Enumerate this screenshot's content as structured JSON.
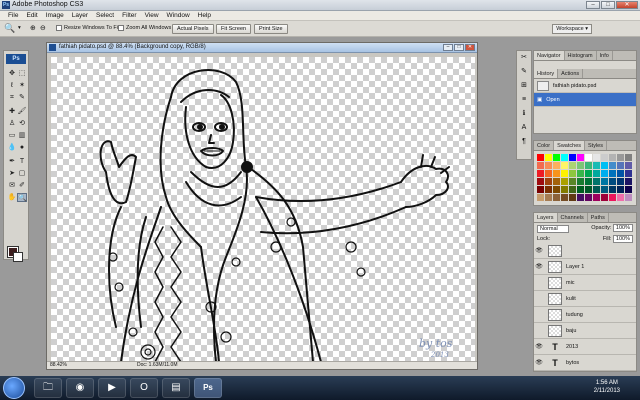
{
  "window": {
    "title": "Adobe Photoshop CS3"
  },
  "menu": [
    "File",
    "Edit",
    "Image",
    "Layer",
    "Select",
    "Filter",
    "View",
    "Window",
    "Help"
  ],
  "options": {
    "resize_windows": "Resize Windows To Fit",
    "zoom_all": "Zoom All Windows",
    "actual_pixels": "Actual Pixels",
    "fit_screen": "Fit Screen",
    "print_size": "Print Size",
    "workspace": "Workspace"
  },
  "tools": {
    "logo": "Ps"
  },
  "document": {
    "title": "fathiah pidato.psd @ 88.4% (Background copy, RGB/8)",
    "zoom": "88.42%",
    "info": "Doc: 1.63M/11.0M",
    "watermark": "by tos",
    "watermark_year": "2013"
  },
  "navigator": {
    "tabs": [
      "Navigator",
      "Histogram",
      "Info"
    ]
  },
  "history": {
    "tabs": [
      "History",
      "Actions"
    ],
    "items": [
      {
        "label": "fathiah pidato.psd"
      },
      {
        "label": "Open"
      }
    ]
  },
  "colorpanel": {
    "tabs": [
      "Color",
      "Swatches",
      "Styles"
    ],
    "swatches": [
      "#ff0000",
      "#ffff00",
      "#00ff00",
      "#00ffff",
      "#0000ff",
      "#ff00ff",
      "#ffffff",
      "#e6e6e6",
      "#cccccc",
      "#b3b3b3",
      "#999999",
      "#808080",
      "#f26c4f",
      "#f68e56",
      "#fbaf5d",
      "#fff568",
      "#acd373",
      "#7cc576",
      "#3bb878",
      "#1abbb4",
      "#00bff3",
      "#438ccb",
      "#5574b9",
      "#605ca8",
      "#ed1c24",
      "#f26522",
      "#f7941d",
      "#fff200",
      "#8dc63f",
      "#39b54a",
      "#00a651",
      "#00a99d",
      "#00aeef",
      "#0072bc",
      "#0054a6",
      "#2e3192",
      "#9e0b0f",
      "#a0410d",
      "#a36209",
      "#aba000",
      "#598527",
      "#1a7b30",
      "#007236",
      "#00746b",
      "#0076a3",
      "#004b80",
      "#003471",
      "#1b1464",
      "#790000",
      "#7b2e00",
      "#7d4900",
      "#827b00",
      "#406618",
      "#005e20",
      "#005826",
      "#005952",
      "#005b7f",
      "#003663",
      "#002157",
      "#0d004c",
      "#c69c6d",
      "#a67c52",
      "#8c6239",
      "#754c24",
      "#603913",
      "#440e62",
      "#630460",
      "#9e005d",
      "#9e0039",
      "#ee145b",
      "#f06eaa",
      "#bd8cbf"
    ]
  },
  "layers": {
    "tabs": [
      "Layers",
      "Channels",
      "Paths"
    ],
    "blend_mode": "Normal",
    "opacity_label": "Opacity:",
    "opacity": "100%",
    "lock_label": "Lock:",
    "fill_label": "Fill:",
    "fill": "100%",
    "items": [
      {
        "name": "",
        "kind": "raster",
        "visible": true
      },
      {
        "name": "Layer 1",
        "kind": "raster",
        "visible": true
      },
      {
        "name": "mic",
        "kind": "raster",
        "visible": false
      },
      {
        "name": "kulit",
        "kind": "raster",
        "visible": false
      },
      {
        "name": "tudung",
        "kind": "raster",
        "visible": false
      },
      {
        "name": "baju",
        "kind": "raster",
        "visible": false
      },
      {
        "name": "2013",
        "kind": "text",
        "visible": true
      },
      {
        "name": "bytos",
        "kind": "text",
        "visible": true
      }
    ]
  },
  "taskbar": {
    "time": "1:56 AM",
    "date": "2/11/2013"
  }
}
